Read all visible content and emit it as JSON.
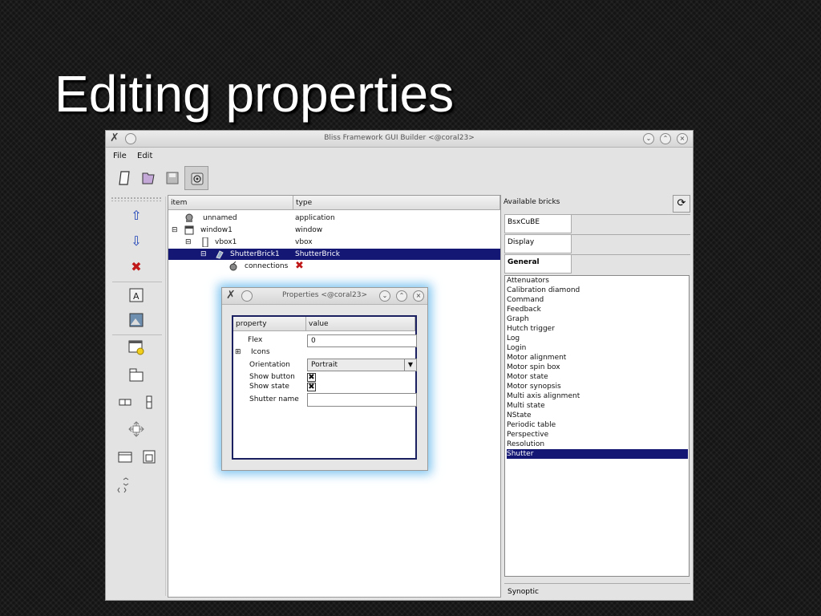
{
  "slide": {
    "title": "Editing properties"
  },
  "window": {
    "title": "Bliss Framework GUI Builder <@coral23>",
    "menu": [
      "File",
      "Edit"
    ],
    "tree": {
      "columns": [
        "item",
        "type"
      ],
      "rows": [
        {
          "item": "unnamed",
          "type": "application",
          "selected": false
        },
        {
          "item": "window1",
          "type": "window",
          "selected": false
        },
        {
          "item": "vbox1",
          "type": "vbox",
          "selected": false
        },
        {
          "item": "ShutterBrick1",
          "type": "ShutterBrick",
          "selected": true
        },
        {
          "item": "connections",
          "type": "",
          "selected": false
        }
      ]
    },
    "bricks": {
      "header": "Available bricks",
      "tabs": [
        "BsxCuBE",
        "Display",
        "General"
      ],
      "items": [
        "Attenuators",
        "Calibration diamond",
        "Command",
        "Feedback",
        "Graph",
        "Hutch trigger",
        "Log",
        "Login",
        "Motor alignment",
        "Motor spin box",
        "Motor state",
        "Motor synopsis",
        "Multi axis alignment",
        "Multi state",
        "NState",
        "Periodic table",
        "Perspective",
        "Resolution",
        "Shutter"
      ],
      "selected": "Shutter",
      "bottom_tab": "Synoptic"
    }
  },
  "dialog": {
    "title": "Properties <@coral23>",
    "columns": [
      "property",
      "value"
    ],
    "flex": {
      "label": "Flex",
      "value": "0"
    },
    "icons": {
      "label": "Icons"
    },
    "orientation": {
      "label": "Orientation",
      "value": "Portrait"
    },
    "show_button": {
      "label": "Show button",
      "checked": true
    },
    "show_state": {
      "label": "Show state",
      "checked": true
    },
    "shutter_name": {
      "label": "Shutter name",
      "value": ""
    }
  }
}
